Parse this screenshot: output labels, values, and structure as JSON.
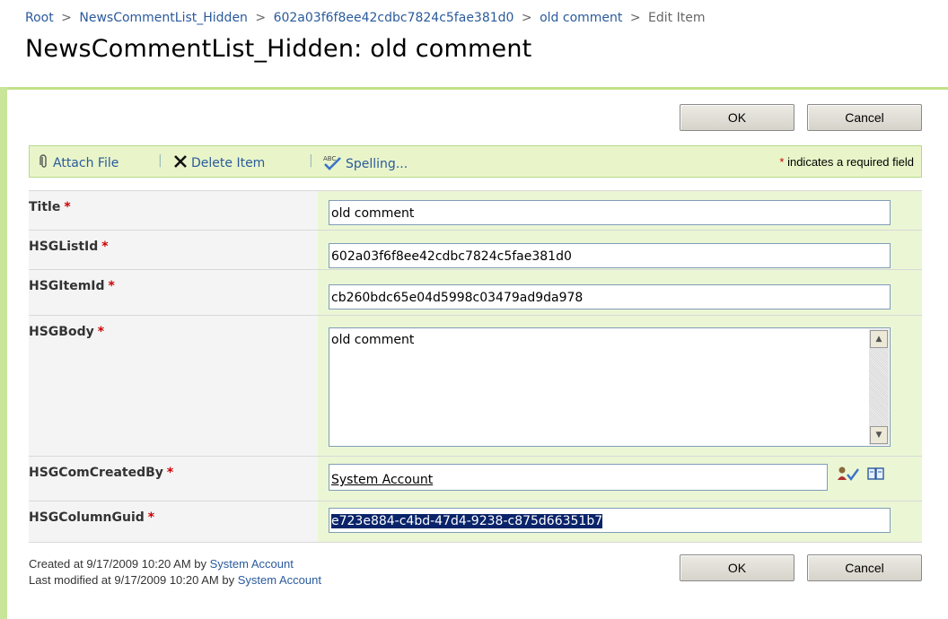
{
  "breadcrumb": {
    "items": [
      "Root",
      "NewsCommentList_Hidden",
      "602a03f6f8ee42cdbc7824c5fae381d0",
      "old comment"
    ],
    "separator": ">",
    "current": "Edit Item"
  },
  "page_title": "NewsCommentList_Hidden: old comment",
  "buttons": {
    "ok": "OK",
    "cancel": "Cancel"
  },
  "toolbar": {
    "attach_file": "Attach File",
    "delete_item": "Delete Item",
    "spelling": "Spelling...",
    "required_star": "*",
    "required_note": " indicates a required field"
  },
  "fields": {
    "title": {
      "label": "Title",
      "value": "old comment"
    },
    "hsglistid": {
      "label": "HSGListId",
      "value": "602a03f6f8ee42cdbc7824c5fae381d0"
    },
    "hsgitemid": {
      "label": "HSGItemId",
      "value": "cb260bdc65e04d5998c03479ad9da978"
    },
    "hsgbody": {
      "label": "HSGBody",
      "value": "old comment"
    },
    "hsgcomcreatedby": {
      "label": "HSGComCreatedBy",
      "value": "System Account"
    },
    "hsgcolumnguid": {
      "label": "HSGColumnGuid",
      "value": "e723e884-c4bd-47d4-9238-c875d66351b7"
    }
  },
  "required_star": "*",
  "footer": {
    "created_prefix": "Created at 9/17/2009 10:20 AM  by ",
    "created_by": "System Account",
    "modified_prefix": "Last modified at 9/17/2009 10:20 AM  by ",
    "modified_by": "System Account"
  },
  "colors": {
    "accent_green": "#c2e18a",
    "link_blue": "#2a5a9c",
    "required_red": "#cc0000",
    "selection_blue": "#0a246a"
  }
}
